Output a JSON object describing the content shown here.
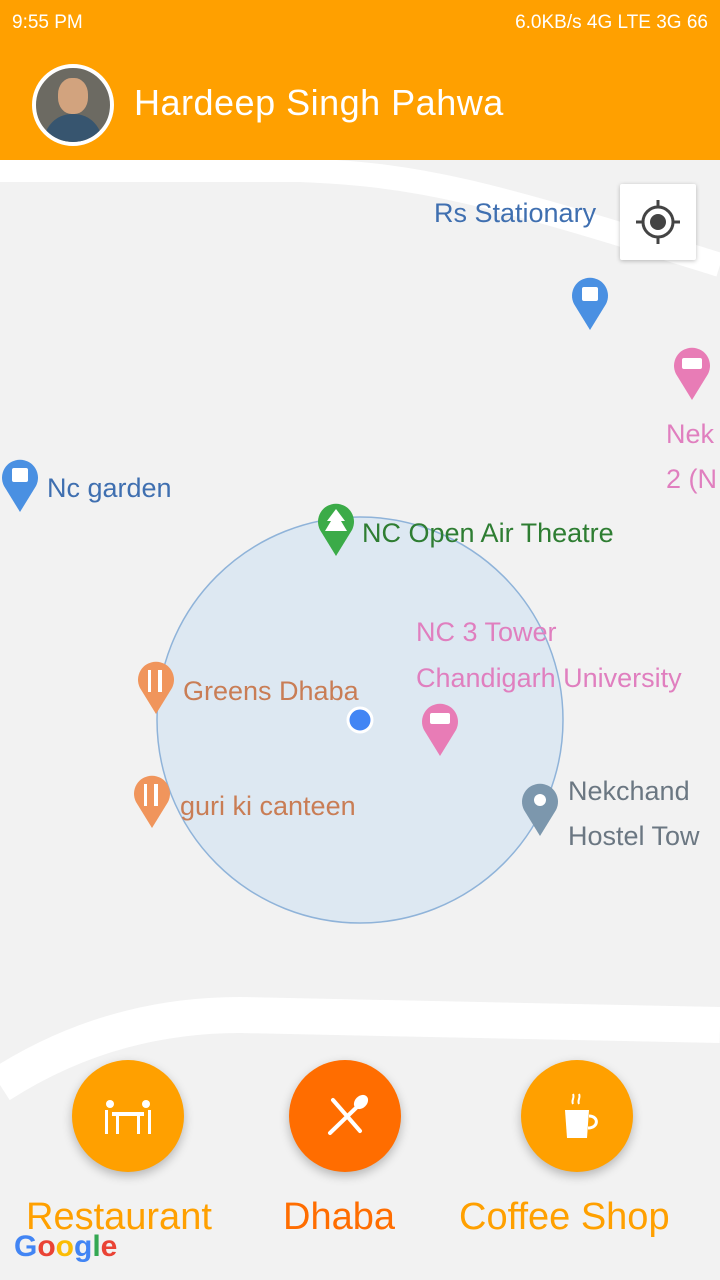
{
  "status_bar": {
    "time": "9:55 PM",
    "right": "6.0KB/s  4G  LTE  3G  66"
  },
  "header": {
    "title": "Hardeep Singh Pahwa"
  },
  "map": {
    "places": [
      {
        "name": "Rs Stationary"
      },
      {
        "name": "Nc garden"
      },
      {
        "name": "NC Open Air Theatre"
      },
      {
        "name": "NC 3 Tower"
      },
      {
        "name": "Chandigarh University"
      },
      {
        "name": "Greens Dhaba"
      },
      {
        "name": "guri ki canteen"
      },
      {
        "name": "Nekchand"
      },
      {
        "name": "Hostel Tow"
      },
      {
        "name": "Nek"
      },
      {
        "name": "2 (N"
      }
    ],
    "attribution": "Google"
  },
  "actions": {
    "restaurant": "Restaurant",
    "dhaba": "Dhaba",
    "coffee": "Coffee Shop"
  },
  "colors": {
    "accent": "#ffa000",
    "dhaba": "#ff6d00",
    "label_blue": "#3f6fb0",
    "label_green": "#2e7d32",
    "label_pink": "#e07fbf",
    "label_orange": "#c97d55",
    "label_gray": "#6b7782"
  }
}
